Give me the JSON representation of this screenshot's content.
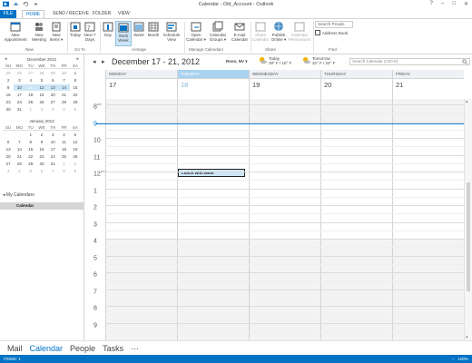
{
  "window": {
    "title": "Calendar - Old_Account - Outlook",
    "controls": [
      "?",
      "–",
      "□",
      "✕"
    ]
  },
  "ribbon_tabs": [
    "FILE",
    "HOME",
    "SEND / RECEIVE",
    "FOLDER",
    "VIEW"
  ],
  "ribbon": {
    "new_appointment": "New\nAppointment",
    "new_meeting": "New\nMeeting",
    "new_items": "New\nItems ▾",
    "today": "Today",
    "next7": "Next 7\nDays",
    "day": "Day",
    "work_week": "Work\nWeek",
    "week": "Week",
    "month": "Month",
    "schedule_view": "Schedule\nView",
    "open_calendar": "Open\nCalendar ▾",
    "calendar_groups": "Calendar\nGroups ▾",
    "email_calendar": "E-mail\nCalendar",
    "share_calendar": "Share\nCalendar",
    "publish_online": "Publish\nOnline ▾",
    "calendar_permissions": "Calendar\nPermissions",
    "search_people_placeholder": "Search People",
    "address_book": "Address Book",
    "groups": [
      "New",
      "Go To",
      "Arrange",
      "Manage Calendars",
      "Share",
      "Find"
    ]
  },
  "minical_dec": {
    "title": "December 2012",
    "days": [
      "SU",
      "MO",
      "TU",
      "WE",
      "TH",
      "FR",
      "SA"
    ],
    "cells": [
      "25",
      "26",
      "27",
      "28",
      "29",
      "30",
      "1",
      "2",
      "3",
      "4",
      "5",
      "6",
      "7",
      "8",
      "9",
      "10",
      "11",
      "12",
      "13",
      "14",
      "15",
      "16",
      "17",
      "18",
      "19",
      "20",
      "21",
      "22",
      "23",
      "24",
      "25",
      "26",
      "27",
      "28",
      "29",
      "30",
      "31",
      "1",
      "2",
      "3",
      "4",
      "5"
    ]
  },
  "minical_jan": {
    "title": "January 2013",
    "days": [
      "SU",
      "MO",
      "TU",
      "WE",
      "TH",
      "FR",
      "SA"
    ],
    "cells": [
      "",
      "",
      "1",
      "2",
      "3",
      "4",
      "5",
      "6",
      "7",
      "8",
      "9",
      "10",
      "11",
      "12",
      "13",
      "14",
      "15",
      "16",
      "17",
      "18",
      "19",
      "20",
      "21",
      "22",
      "23",
      "24",
      "25",
      "26",
      "27",
      "28",
      "29",
      "30",
      "31",
      "1",
      "2",
      "3",
      "4",
      "5",
      "6",
      "7",
      "8",
      "9"
    ]
  },
  "my_calendars": {
    "heading": "◂ My Calendars",
    "item": "Calendar"
  },
  "calheader": {
    "date_range": "December 17 - 21, 2012",
    "location": "Reno, NV ▾",
    "today_label": "Today",
    "today_temp": "29° F / 10° F",
    "tomorrow_label": "Tomorrow",
    "tomorrow_temp": "32° F / 24° F",
    "search_placeholder": "Search Calendar (Ctrl+E)"
  },
  "days": [
    {
      "name": "MONDAY",
      "num": "17"
    },
    {
      "name": "TUESDAY",
      "num": "18"
    },
    {
      "name": "WEDNESDAY",
      "num": "19"
    },
    {
      "name": "THURSDAY",
      "num": "20"
    },
    {
      "name": "FRIDAY",
      "num": "21"
    }
  ],
  "times": [
    {
      "label": "8",
      "sup": "am"
    },
    {
      "label": "9",
      "sup": ""
    },
    {
      "label": "10",
      "sup": ""
    },
    {
      "label": "11",
      "sup": ""
    },
    {
      "label": "12",
      "sup": "pm"
    },
    {
      "label": "1",
      "sup": ""
    },
    {
      "label": "2",
      "sup": ""
    },
    {
      "label": "3",
      "sup": ""
    },
    {
      "label": "4",
      "sup": ""
    },
    {
      "label": "5",
      "sup": ""
    },
    {
      "label": "6",
      "sup": ""
    },
    {
      "label": "7",
      "sup": ""
    },
    {
      "label": "8",
      "sup": ""
    },
    {
      "label": "9",
      "sup": ""
    }
  ],
  "appointment": "Lunch with Mom",
  "bottom_nav": [
    "Mail",
    "Calendar",
    "People",
    "Tasks",
    "···"
  ],
  "status": {
    "items": "ITEMS: 1",
    "zoom": "100%"
  },
  "colors": {
    "accent": "#0072c6",
    "selected_day": "#a9d3f0",
    "appointment_fill": "#cde6f7"
  }
}
